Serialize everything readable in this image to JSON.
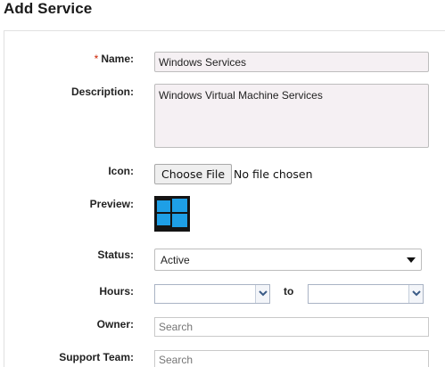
{
  "page": {
    "title": "Add Service"
  },
  "form": {
    "name": {
      "label": "Name:",
      "required_mark": "*",
      "value": "Windows Services"
    },
    "description": {
      "label": "Description:",
      "value": "Windows Virtual Machine Services"
    },
    "icon": {
      "label": "Icon:",
      "button_label": "Choose File",
      "status": "No file chosen"
    },
    "preview": {
      "label": "Preview:",
      "icon": "windows-logo-icon"
    },
    "status": {
      "label": "Status:",
      "value": "Active"
    },
    "hours": {
      "label": "Hours:",
      "from_value": "",
      "to_label": "to",
      "to_value": ""
    },
    "owner": {
      "label": "Owner:",
      "placeholder": "Search"
    },
    "support_team": {
      "label": "Support Team:",
      "placeholder": "Search"
    }
  },
  "colors": {
    "required": "#cc2200",
    "windows_blue": "#1e9fe6",
    "tile_bg": "#141414"
  }
}
